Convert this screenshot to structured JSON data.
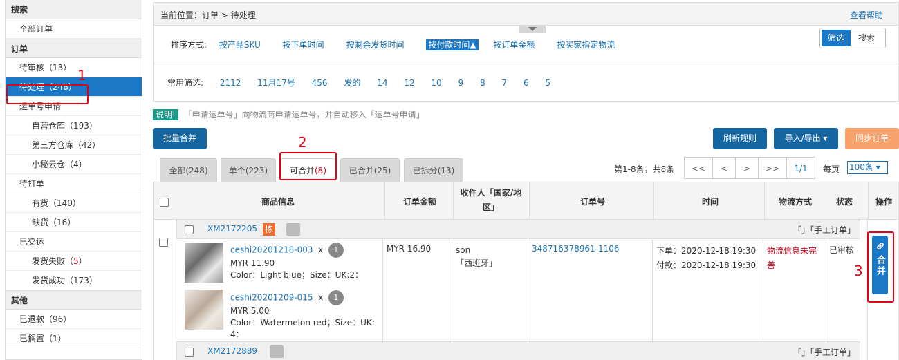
{
  "sidebar": {
    "search_head": "搜索",
    "all_orders": "全部订单",
    "orders_head": "订单",
    "pending_review": {
      "label": "待审核",
      "count": "（13）"
    },
    "pending": {
      "label": "待处理",
      "count": "（248）"
    },
    "tracking_apply": "运单号申请",
    "self_wh": {
      "label": "自营仓库",
      "count": "（193）"
    },
    "third_wh": {
      "label": "第三方仓库",
      "count": "（42）"
    },
    "xm_wh": {
      "label": "小秘云仓",
      "count": "（4）"
    },
    "to_print": "待打单",
    "in_stock": {
      "label": "有货",
      "count": "（140）"
    },
    "out_stock": {
      "label": "缺货",
      "count": "（16）"
    },
    "shipped": "已交运",
    "ship_fail": {
      "label": "发货失败",
      "count_open": "（",
      "count_num": "5",
      "count_close": "）"
    },
    "ship_ok": {
      "label": "发货成功",
      "count": "（173）"
    },
    "other_head": "其他",
    "refunded": {
      "label": "已退款",
      "count": "（96）"
    },
    "shelved": {
      "label": "已搁置",
      "count": "（1）"
    }
  },
  "annotations": [
    "1",
    "2",
    "3"
  ],
  "topbar": {
    "crumb": "当前位置：订单 > 待处理",
    "help": "查看帮助"
  },
  "sort": {
    "label": "排序方式:",
    "options": [
      "按产品SKU",
      "按下单时间",
      "按剩余发货时间",
      "按付款时间▲",
      "按订单金额",
      "按买家指定物流"
    ]
  },
  "quick_filter": {
    "label": "常用筛选:",
    "options": [
      "2112",
      "11月17号",
      "456",
      "发的",
      "14",
      "12",
      "10",
      "9",
      "8",
      "7",
      "6",
      "5"
    ]
  },
  "segment": {
    "filter": "筛选",
    "search": "搜索"
  },
  "note": {
    "tag": "说明!",
    "text": "「申请运单号」向物流商申请运单号，并自动移入「运单号申请」"
  },
  "buttons": {
    "batch_merge": "批量合并",
    "refresh_rules": "刷新规则",
    "import_export": "导入/导出 ▾",
    "sync_orders": "同步订单"
  },
  "tabs": [
    {
      "label": "全部",
      "count": "(248)"
    },
    {
      "label": "单个",
      "count": "(223)"
    },
    {
      "label": "可合并",
      "count": "(8)"
    },
    {
      "label": "已合并",
      "count": "(25)"
    },
    {
      "label": "已拆分",
      "count": "(13)"
    }
  ],
  "pager": {
    "summary": "第1-8条，共8条",
    "first": "<<",
    "prev": "<",
    "next": ">",
    "last": ">>",
    "page": "1/1",
    "per_page_label": "每页",
    "per_page": "100条 ▾"
  },
  "table_headers": {
    "product": "商品信息",
    "amount": "订单金额",
    "receiver_1": "收件人「国家/地",
    "receiver_2": "区」",
    "order_no": "订单号",
    "time": "时间",
    "logistics": "物流方式",
    "status": "状态",
    "action": "操作"
  },
  "orders": [
    {
      "id": "XM2172205",
      "badge": "拣",
      "type": "「」「手工订单」",
      "items": [
        {
          "sku": "ceshi20201218-003",
          "x": "x",
          "qty": "1",
          "price": "MYR 11.90",
          "attrs": "Color：Light blue；Size：UK:2："
        },
        {
          "sku": "ceshi20201209-015",
          "x": "x",
          "qty": "1",
          "price": "MYR 5.00",
          "attrs_1": "Color：Watermelon red；Size：UK:",
          "attrs_2": "4："
        }
      ],
      "amount": "MYR 16.90",
      "receiver": "son",
      "country": "「西班牙」",
      "order_no": "348716378961-1106",
      "ordered": "下单：2020-12-18 19:30",
      "paid": "付款：2020-12-18 19:30",
      "logistics_1": "物流信息未完",
      "logistics_2": "善",
      "status": "已审核",
      "action_icon": "link-icon",
      "action_label": "合并"
    },
    {
      "id": "XM2172889",
      "type": "「」「手工订单」"
    }
  ],
  "colors": {
    "primary": "#1b78c7",
    "dark_button": "#1565a0",
    "orange_button": "#f7a26d",
    "annotation": "#e60012",
    "note_tag": "#1a9a8a"
  }
}
